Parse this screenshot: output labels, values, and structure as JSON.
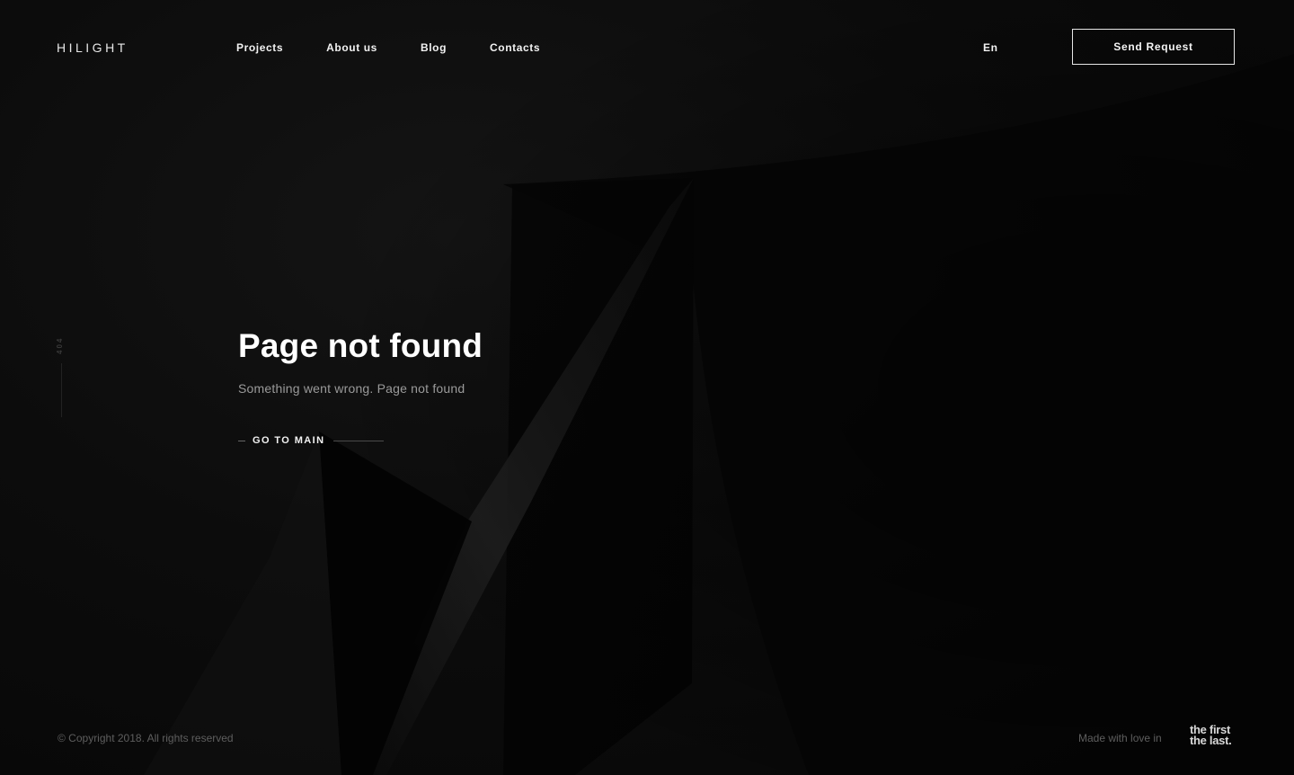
{
  "header": {
    "logo": "HILIGHT",
    "nav": [
      {
        "label": "Projects"
      },
      {
        "label": "About us"
      },
      {
        "label": "Blog"
      },
      {
        "label": "Contacts"
      }
    ],
    "language": "En",
    "cta_label": "Send Request"
  },
  "side": {
    "code": "404"
  },
  "main": {
    "title": "Page not found",
    "subtitle": "Something went wrong. Page not found",
    "link_label": "GO TO MAIN"
  },
  "footer": {
    "copyright": "© Copyright 2018. All rights reserved",
    "made_with": "Made with love in",
    "studio_line1": "the first",
    "studio_line2": "the last."
  },
  "colors": {
    "background": "#0a0a0a",
    "text": "#ffffff",
    "muted": "#5e5e5e"
  }
}
